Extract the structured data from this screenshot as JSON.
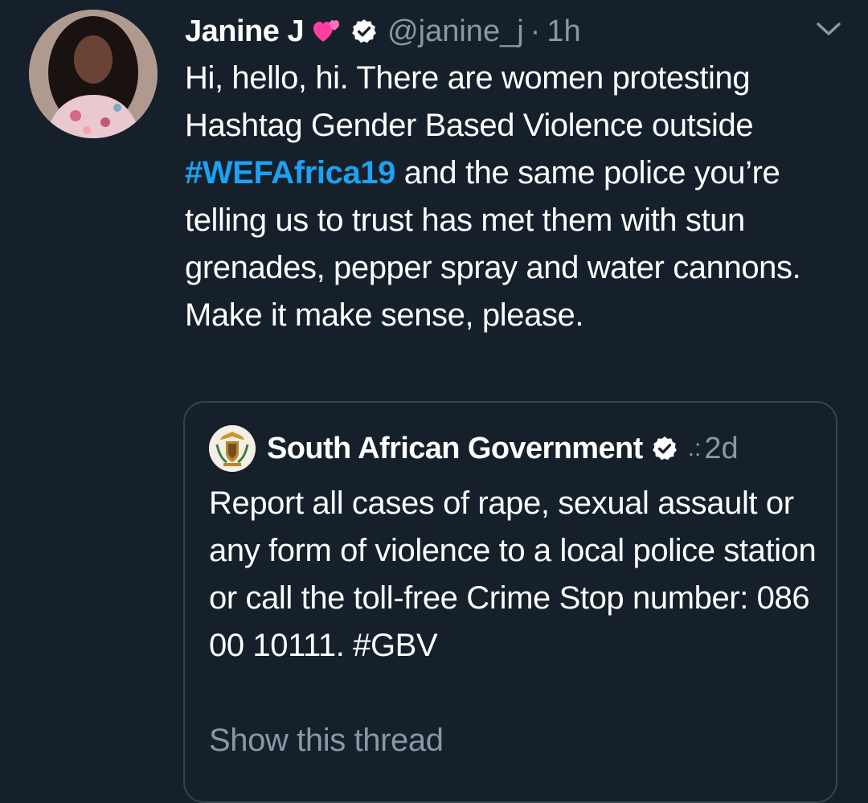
{
  "tweet": {
    "display_name": "Janine J",
    "name_emoji": "💕",
    "handle": "@janine_j",
    "separator": "·",
    "time": "1h",
    "text_before": "Hi, hello, hi. There are women protesting Hashtag Gender Based Violence outside ",
    "hashtag": "#WEFAfrica19",
    "text_after": " and the same police you’re telling us to trust has met them with stun grenades, pepper spray and water cannons. Make it make sense, please.",
    "icons": {
      "avatar": "profile-photo",
      "verified": "verified-badge-icon",
      "menu": "chevron-down-icon"
    }
  },
  "quoted_tweet": {
    "display_name": "South African Government",
    "more": ".:",
    "time": "2d",
    "text": "Report all cases of rape, sexual assault or any form of violence to a local police station or call the toll-free Crime Stop number: 086 00 10111. #GBV",
    "show_thread": "Show this thread",
    "icons": {
      "avatar": "coat-of-arms-avatar",
      "verified": "verified-badge-icon"
    }
  },
  "colors": {
    "background": "#15202b",
    "text": "#ffffff",
    "secondary": "#8899a6",
    "link": "#1da1f2",
    "border": "#38444d"
  }
}
